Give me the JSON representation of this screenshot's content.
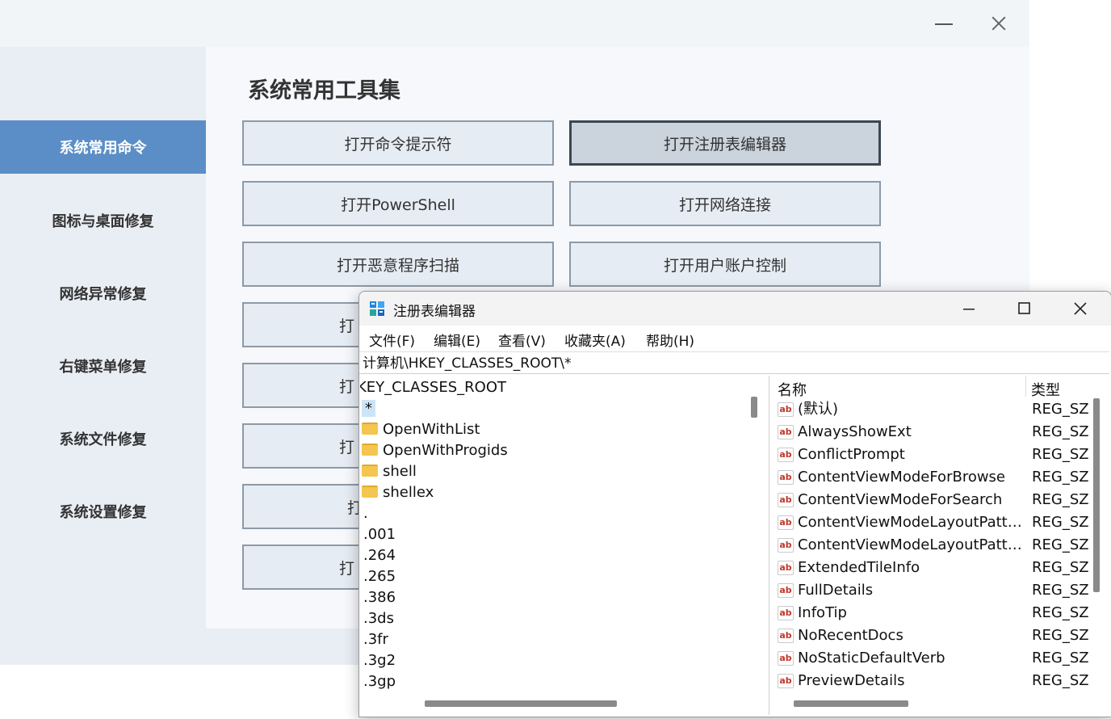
{
  "app": {
    "page_title": "系统常用工具集",
    "sidebar": {
      "items": [
        {
          "label": "系统常用命令",
          "active": true
        },
        {
          "label": "图标与桌面修复"
        },
        {
          "label": "网络异常修复"
        },
        {
          "label": "右键菜单修复"
        },
        {
          "label": "系统文件修复"
        },
        {
          "label": "系统设置修复"
        }
      ]
    },
    "tools": [
      "打开命令提示符",
      "打开注册表编辑器",
      "打开PowerShell",
      "打开网络连接",
      "打开恶意程序扫描",
      "打开用户账户控制",
      "打",
      "打",
      "打",
      "打",
      "打"
    ],
    "highlighted_tool": "打开注册表编辑器"
  },
  "regedit": {
    "title": "注册表编辑器",
    "menu": [
      "文件(F)",
      "编辑(E)",
      "查看(V)",
      "收藏夹(A)",
      "帮助(H)"
    ],
    "address": "计算机\\HKEY_CLASSES_ROOT\\*",
    "tree": [
      {
        "label": "KEY_CLASSES_ROOT",
        "folder": false
      },
      {
        "label": "*",
        "folder": false,
        "selected": true
      },
      {
        "label": "OpenWithList",
        "folder": true
      },
      {
        "label": "OpenWithProgids",
        "folder": true
      },
      {
        "label": "shell",
        "folder": true
      },
      {
        "label": "shellex",
        "folder": true
      },
      {
        "label": ".",
        "folder": false
      },
      {
        "label": ".001",
        "folder": false
      },
      {
        "label": ".264",
        "folder": false
      },
      {
        "label": ".265",
        "folder": false
      },
      {
        "label": ".386",
        "folder": false
      },
      {
        "label": ".3ds",
        "folder": false
      },
      {
        "label": ".3fr",
        "folder": false
      },
      {
        "label": ".3g2",
        "folder": false
      },
      {
        "label": ".3gp",
        "folder": false
      }
    ],
    "columns": {
      "name": "名称",
      "type": "类型"
    },
    "values": [
      {
        "name": "(默认)",
        "type": "REG_SZ"
      },
      {
        "name": "AlwaysShowExt",
        "type": "REG_SZ"
      },
      {
        "name": "ConflictPrompt",
        "type": "REG_SZ"
      },
      {
        "name": "ContentViewModeForBrowse",
        "type": "REG_SZ"
      },
      {
        "name": "ContentViewModeForSearch",
        "type": "REG_SZ"
      },
      {
        "name": "ContentViewModeLayoutPatte...",
        "type": "REG_SZ"
      },
      {
        "name": "ContentViewModeLayoutPatte...",
        "type": "REG_SZ"
      },
      {
        "name": "ExtendedTileInfo",
        "type": "REG_SZ"
      },
      {
        "name": "FullDetails",
        "type": "REG_SZ"
      },
      {
        "name": "InfoTip",
        "type": "REG_SZ"
      },
      {
        "name": "NoRecentDocs",
        "type": "REG_SZ"
      },
      {
        "name": "NoStaticDefaultVerb",
        "type": "REG_SZ"
      },
      {
        "name": "PreviewDetails",
        "type": "REG_SZ"
      }
    ],
    "value_icon": "ab"
  },
  "colors": {
    "sidebar_active": "#5b8ec6",
    "button_bg": "#e6ecf3",
    "button_highlight_bg": "#cbd3dc",
    "selection": "#cce4f7"
  }
}
